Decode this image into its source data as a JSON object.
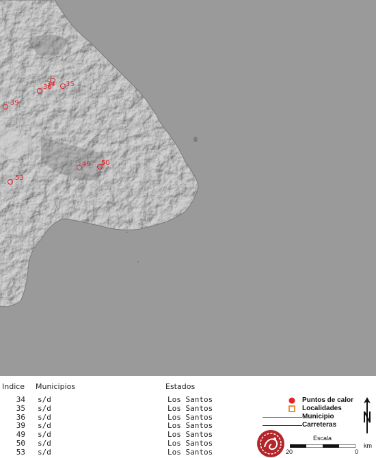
{
  "map": {
    "sea_color": "#9a9a9a",
    "land_color": "#8a8a8a",
    "hotspot_color": "#e8202a",
    "points": [
      {
        "label": "34"
      },
      {
        "label": "35"
      },
      {
        "label": "36"
      },
      {
        "label": "39"
      },
      {
        "label": "49"
      },
      {
        "label": "50"
      },
      {
        "label": "53"
      }
    ]
  },
  "table": {
    "headers": {
      "indice": "Indice",
      "municipios": "Municipios",
      "estados": "Estados"
    },
    "rows": [
      {
        "indice": "34",
        "municipio": "s/d",
        "estado": "Los Santos"
      },
      {
        "indice": "35",
        "municipio": "s/d",
        "estado": "Los Santos"
      },
      {
        "indice": "36",
        "municipio": "s/d",
        "estado": "Los Santos"
      },
      {
        "indice": "39",
        "municipio": "s/d",
        "estado": "Los Santos"
      },
      {
        "indice": "49",
        "municipio": "s/d",
        "estado": "Los Santos"
      },
      {
        "indice": "50",
        "municipio": "s/d",
        "estado": "Los Santos"
      },
      {
        "indice": "53",
        "municipio": "s/d",
        "estado": "Los Santos"
      }
    ]
  },
  "legend": {
    "hotspots": "Puntos de calor",
    "localities": "Localidades",
    "municipality": "Municipio",
    "roads": "Carreteras",
    "scale_title": "Escala",
    "scale_left": "20",
    "scale_right": "0",
    "scale_unit": "km",
    "hotspot_color": "#e8202a",
    "locality_color": "#e07a10",
    "municipality_color": "#c0308a",
    "roads_color": "#333333",
    "north_icon": "north-arrow-icon",
    "logo_icon": "agency-logo-icon"
  }
}
